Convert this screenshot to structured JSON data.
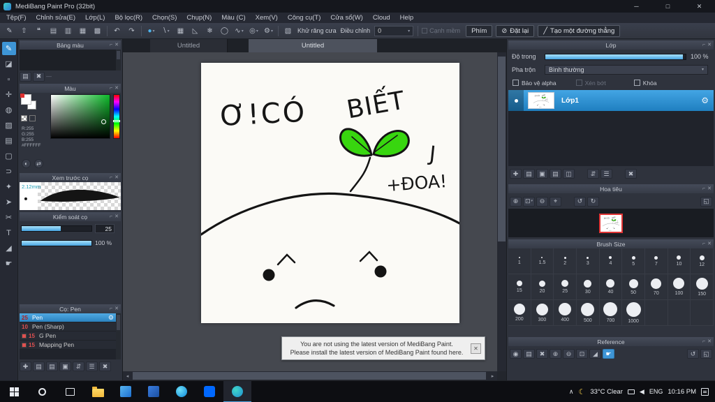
{
  "window": {
    "title": "MediBang Paint Pro (32bit)"
  },
  "menu": {
    "items": [
      "Tệp(F)",
      "Chỉnh sửa(E)",
      "Lớp(L)",
      "Bộ lọc(R)",
      "Chọn(S)",
      "Chụp(N)",
      "Màu (C)",
      "Xem(V)",
      "Công cụ(T)",
      "Cửa sổ(W)",
      "Cloud",
      "Help"
    ]
  },
  "toolbar": {
    "antialias_label": "Khử răng cưa",
    "adjust_label": "Điều chỉnh",
    "adjust_value": "0",
    "soft_edge_label": "Cạnh mềm",
    "key_button": "Phím",
    "reset_button": "Đặt lại",
    "line_button": "Tạo một đường thẳng"
  },
  "tabs": {
    "tab1": "Untitled",
    "tab2": "Untitled"
  },
  "drawing": {
    "text1": "Ơ!CÓ",
    "text2": "BIẾT",
    "text3": "J",
    "text4": "+ĐOA!"
  },
  "notification": {
    "line1": "You are not using the latest version of MediBang Paint.",
    "line2": "Please install the latest version of MediBang Paint found here.",
    "close": "✕"
  },
  "left": {
    "palette": {
      "title": "Bảng màu"
    },
    "color": {
      "title": "Màu",
      "r": "R:255",
      "g": "G:255",
      "b": "B:255",
      "hex": "#FFFFFF"
    },
    "preview": {
      "title": "Xem trước cọ",
      "size": "2.12mm"
    },
    "control": {
      "title": "Kiểm soát cọ",
      "size_value": "25",
      "opacity_value": "100 %"
    },
    "brushes": {
      "title": "Cọ: Pen",
      "items": [
        {
          "size": "25",
          "name": "Pen"
        },
        {
          "size": "10",
          "name": "Pen (Sharp)"
        },
        {
          "size": "15",
          "name": "G Pen"
        },
        {
          "size": "15",
          "name": "Mapping Pen"
        }
      ]
    }
  },
  "right": {
    "layer": {
      "title": "Lớp",
      "opacity_label": "Độ trong",
      "opacity_value": "100 %",
      "blend_label": "Pha trộn",
      "blend_value": "Bình thường",
      "protect_alpha_label": "Bảo vệ alpha",
      "clipping_label": "Xén bớt",
      "lock_label": "Khóa",
      "layer1_name": "Lớp1"
    },
    "navigator": {
      "title": "Hoa tiêu"
    },
    "brush_size": {
      "title": "Brush Size",
      "sizes": [
        "1",
        "1.5",
        "2",
        "3",
        "4",
        "5",
        "7",
        "10",
        "12",
        "15",
        "20",
        "25",
        "30",
        "40",
        "50",
        "70",
        "100",
        "150",
        "200",
        "300",
        "400",
        "500",
        "700",
        "1000"
      ]
    },
    "reference": {
      "title": "Reference"
    }
  },
  "taskbar": {
    "weather": "33°C Clear",
    "language": "ENG",
    "time": "10:16 PM"
  },
  "colors": {
    "accent": "#3e95d6",
    "selection_blue": "#2b83c0",
    "clover_green": "#38d60f",
    "paper": "#fbfaf6",
    "canvas_background": "#45484f",
    "navigator_view_border": "#e23636"
  },
  "icons": {
    "minimize": "─",
    "maximize": "□",
    "close": "✕",
    "popout": "⌐",
    "panel_close": "✕",
    "draw": "✎",
    "upload": "⇧",
    "comment": "❝",
    "page": "▤",
    "pages": "▥",
    "grid_small": "▦",
    "table": "▩",
    "undo": "↶",
    "redo": "↷",
    "brush_tip": "●",
    "stroke": "∖",
    "grid": "▦",
    "ruler": "◺",
    "symmetry": "❄",
    "circle": "◯",
    "curve": "∿",
    "target": "◎",
    "gear": "⚙",
    "dropdown": "▾",
    "antialias": "▧",
    "reset": "⊘",
    "line": "╱",
    "brush": "✎",
    "eraser": "◪",
    "dot": "▫",
    "move": "✛",
    "fill": "◍",
    "gradient": "▨",
    "bucket": "▤",
    "select": "▢",
    "lasso": "⊃",
    "wand": "✦",
    "cursor": "➤",
    "divide": "✂",
    "text": "T",
    "picker": "◢",
    "hand": "☛",
    "half": "◐",
    "swap": "⇄",
    "dash": "—",
    "zoom_in": "⊕",
    "zoom_out": "⊖",
    "zoom_fit": "⊡",
    "zoom_orig": "⌖",
    "rotate_left": "↺",
    "rotate_right": "↻",
    "expand": "◱",
    "plus": "✚",
    "duplicate": "▣",
    "merge": "◫",
    "folder": "▤",
    "updown": "⇵",
    "menu": "☰",
    "delete": "✖",
    "eye": "◉",
    "arrow_left": "◂",
    "arrow_right": "▸",
    "chevron_up": "∧",
    "moon": "☾",
    "speaker": "◀"
  }
}
